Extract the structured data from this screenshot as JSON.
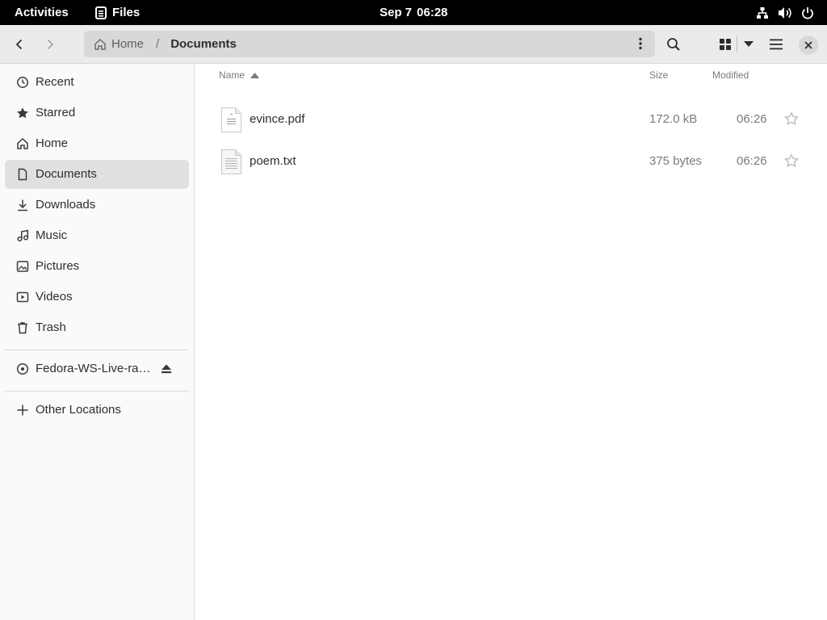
{
  "topbar": {
    "activities": "Activities",
    "app_name": "Files",
    "date": "Sep 7",
    "time": "06:28"
  },
  "headerbar": {
    "breadcrumb": {
      "home": "Home",
      "separator": "/",
      "current": "Documents"
    }
  },
  "sidebar": {
    "items": [
      {
        "label": "Recent",
        "icon": "clock-icon"
      },
      {
        "label": "Starred",
        "icon": "star-icon"
      },
      {
        "label": "Home",
        "icon": "home-icon"
      },
      {
        "label": "Documents",
        "icon": "document-icon",
        "selected": true
      },
      {
        "label": "Downloads",
        "icon": "download-icon"
      },
      {
        "label": "Music",
        "icon": "music-icon"
      },
      {
        "label": "Pictures",
        "icon": "picture-icon"
      },
      {
        "label": "Videos",
        "icon": "video-icon"
      },
      {
        "label": "Trash",
        "icon": "trash-icon"
      }
    ],
    "drive": {
      "label": "Fedora-WS-Live-ra…",
      "icon": "disc-icon"
    },
    "other": {
      "label": "Other Locations",
      "icon": "plus-icon"
    }
  },
  "filelist": {
    "columns": {
      "name": "Name",
      "size": "Size",
      "modified": "Modified"
    },
    "files": [
      {
        "name": "evince.pdf",
        "size": "172.0 kB",
        "modified": "06:26",
        "type": "pdf"
      },
      {
        "name": "poem.txt",
        "size": "375 bytes",
        "modified": "06:26",
        "type": "text"
      }
    ]
  },
  "colors": {
    "topbar_bg": "#000000",
    "headerbar_bg": "#ebebeb",
    "sidebar_bg": "#fafafa",
    "selected_bg": "#e0e0e0"
  }
}
